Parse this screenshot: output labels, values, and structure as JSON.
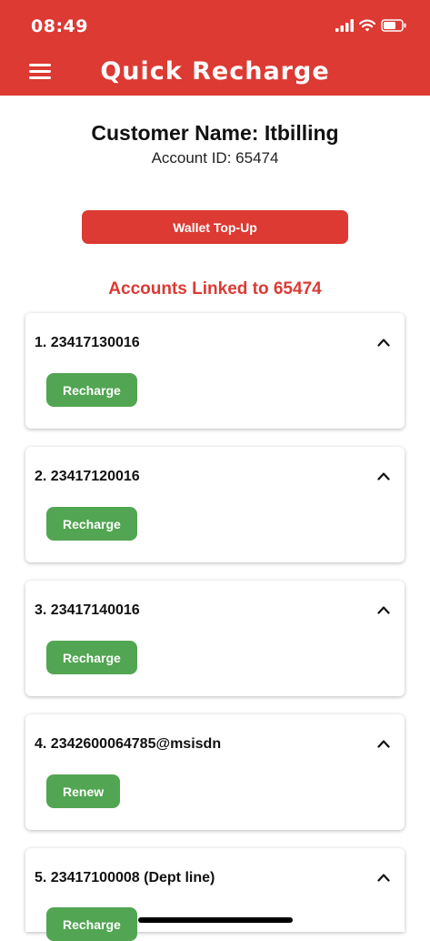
{
  "status": {
    "time": "08:49"
  },
  "header": {
    "title": "Quick Recharge"
  },
  "customer": {
    "name": "Customer Name: Itbilling",
    "account": "Account ID: 65474"
  },
  "wallet": {
    "label": "Wallet Top-Up"
  },
  "linked": {
    "title": "Accounts Linked to 65474"
  },
  "accounts": [
    {
      "title": "1. 23417130016",
      "action": "Recharge"
    },
    {
      "title": "2. 23417120016",
      "action": "Recharge"
    },
    {
      "title": "3. 23417140016",
      "action": "Recharge"
    },
    {
      "title": "4. 2342600064785@msisdn",
      "action": "Renew"
    },
    {
      "title": "5. 23417100008 (Dept line)",
      "action": "Recharge"
    }
  ],
  "colors": {
    "brand": "#dc3a33",
    "action": "#52a552"
  }
}
